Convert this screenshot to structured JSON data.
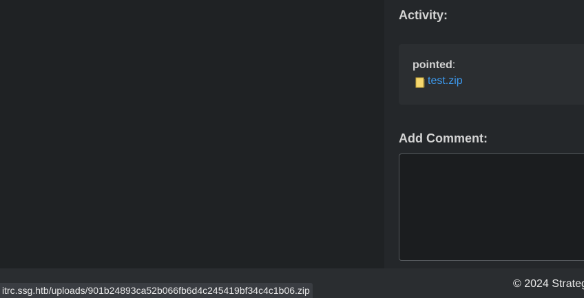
{
  "activity": {
    "heading": "Activity:",
    "entries": [
      {
        "user": "pointed",
        "separator": ":",
        "attachment": {
          "filename": "test.zip",
          "icon": "file-archive-icon"
        }
      }
    ]
  },
  "comment": {
    "heading": "Add Comment:",
    "value": ""
  },
  "footer": {
    "copyright": "© 2024 Strateg"
  },
  "status_bar": {
    "url": "itrc.ssg.htb/uploads/901b24893ca52b066fb6d4c245419bf34c4c1b06.zip"
  },
  "colors": {
    "link": "#3d9bf0",
    "file_icon": "#f5d76e"
  }
}
